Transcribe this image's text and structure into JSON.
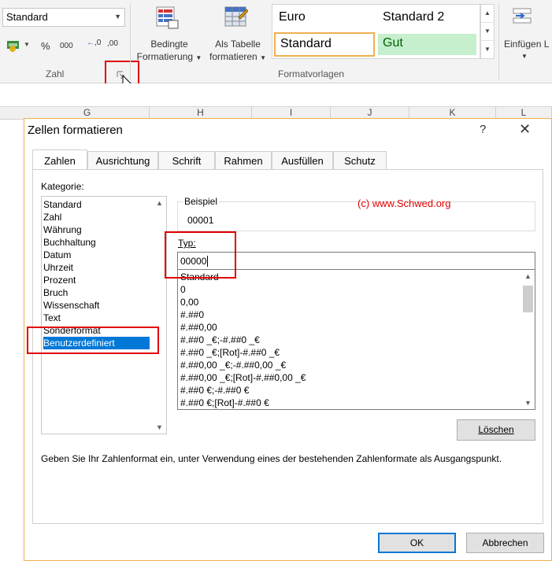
{
  "ribbon": {
    "number_format_value": "Standard",
    "buttons": {
      "currency": "€",
      "percent": "%",
      "thousands": "000",
      "dec_increase": ",0",
      "dec_decrease": ",00"
    },
    "group_zahl": "Zahl",
    "conditional_line1": "Bedingte",
    "conditional_line2": "Formatierung",
    "table_line1": "Als Tabelle",
    "table_line2": "formatieren",
    "styles": {
      "euro": "Euro",
      "standard2": "Standard 2",
      "standard": "Standard",
      "gut": "Gut"
    },
    "group_formatvorlagen": "Formatvorlagen",
    "insert_label": "Einfügen",
    "insert_partial": "L",
    "colors": {
      "gut_bg": "#c6efce",
      "gut_fg": "#006100",
      "standard_border": "#f0b050"
    }
  },
  "sheet": {
    "columns": [
      "G",
      "H",
      "I",
      "J",
      "K",
      "L"
    ]
  },
  "dialog": {
    "title": "Zellen formatieren",
    "help": "?",
    "close": "✕",
    "tabs": [
      "Zahlen",
      "Ausrichtung",
      "Schrift",
      "Rahmen",
      "Ausfüllen",
      "Schutz"
    ],
    "active_tab": "Zahlen",
    "category_label": "Kategorie:",
    "categories": [
      "Standard",
      "Zahl",
      "Währung",
      "Buchhaltung",
      "Datum",
      "Uhrzeit",
      "Prozent",
      "Bruch",
      "Wissenschaft",
      "Text",
      "Sonderformat",
      "Benutzerdefiniert"
    ],
    "selected_category": "Benutzerdefiniert",
    "sample_label": "Beispiel",
    "sample_value": "00001",
    "copyright": "(c) www.Schwed.org",
    "type_label": "Typ:",
    "type_value": "00000",
    "formats": [
      "Standard",
      "0",
      "0,00",
      "#.##0",
      "#.##0,00",
      "#.##0 _€;-#.##0 _€",
      "#.##0 _€;[Rot]-#.##0 _€",
      "#.##0,00 _€;-#.##0,00 _€",
      "#.##0,00 _€;[Rot]-#.##0,00 _€",
      "#.##0 €;-#.##0 €",
      "#.##0 €;[Rot]-#.##0 €"
    ],
    "delete_button": "Löschen",
    "hint": "Geben Sie Ihr Zahlenformat ein, unter Verwendung eines der bestehenden Zahlenformate als Ausgangspunkt.",
    "ok_button": "OK",
    "cancel_button": "Abbrechen"
  }
}
